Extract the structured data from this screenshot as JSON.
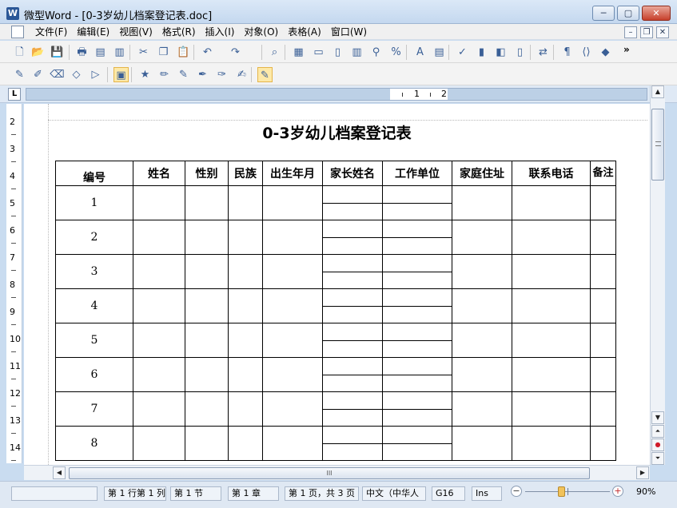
{
  "window": {
    "title": "微型Word - [0-3岁幼儿档案登记表.doc]",
    "app_icon_letter": "W",
    "minimize": "─",
    "maximize": "▢",
    "close": "✕"
  },
  "menu": {
    "items": [
      "文件(F)",
      "编辑(E)",
      "视图(V)",
      "格式(R)",
      "插入(I)",
      "对象(O)",
      "表格(A)",
      "窗口(W)"
    ],
    "mdi_minimize": "–",
    "mdi_restore": "❐",
    "mdi_close": "✕"
  },
  "toolbar1": {
    "icons": [
      "new-document-icon",
      "open-folder-icon",
      "save-icon",
      "print-icon",
      "pdf-icon",
      "print-preview-icon",
      "cut-icon",
      "copy-icon",
      "paste-icon",
      "undo-icon",
      "redo-icon",
      "find-icon",
      "table-icon",
      "frame-icon",
      "page-icon",
      "columns-icon",
      "zoom-icon",
      "percent-icon",
      "font-color-icon",
      "format-icon",
      "spellcheck-icon",
      "chart-icon",
      "layers-icon",
      "text-box-icon",
      "compare-icon",
      "paragraph-mark-icon",
      "field-icon",
      "object-icon"
    ],
    "more": "»"
  },
  "toolbar2": {
    "icons": [
      "edit-table-icon",
      "draw-icon",
      "erase-icon",
      "shape-icon",
      "insert-shape-icon",
      "highlight-icon",
      "star-icon",
      "pencil-icon",
      "brush-icon",
      "ruler-pen-icon",
      "marker-icon",
      "note-icon",
      "track-changes-icon"
    ]
  },
  "ruler": {
    "tab_selector": "L",
    "numbers": [
      "1",
      "2"
    ]
  },
  "vruler": {
    "numbers": [
      "2",
      "3",
      "4",
      "5",
      "6",
      "7",
      "8",
      "9",
      "10",
      "11",
      "12",
      "13",
      "14"
    ]
  },
  "document": {
    "title": "0-3岁幼儿档案登记表",
    "columns": [
      "编号",
      "姓名",
      "性别",
      "民族",
      "出生年月",
      "家长姓名",
      "工作单位",
      "家庭住址",
      "联系电话",
      "备注"
    ],
    "rows": [
      "1",
      "2",
      "3",
      "4",
      "5",
      "6",
      "7",
      "8"
    ]
  },
  "scrollbar": {
    "up": "▲",
    "down": "▼",
    "prev_page": "⏶",
    "select_browse": "●",
    "next_page": "⏷",
    "left": "◀",
    "right": "▶",
    "grip": "III"
  },
  "status": {
    "blank": "",
    "position": "第 1 行第 1 列",
    "section": "第 1 节",
    "chapter": "第 1 章",
    "page": "第 1 页，共 3 页",
    "language": "中文（中华人",
    "grid": "G16",
    "ins": "Ins",
    "zoom": "90%",
    "zoom_minus": "−",
    "zoom_plus": "+"
  }
}
